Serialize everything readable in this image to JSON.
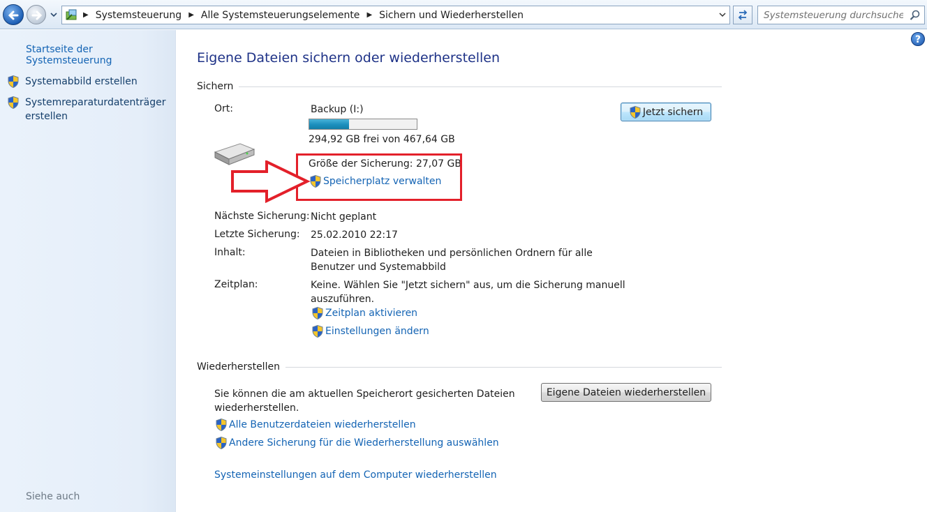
{
  "address_bar": {
    "breadcrumbs": [
      "Systemsteuerung",
      "Alle Systemsteuerungselemente",
      "Sichern und Wiederherstellen"
    ],
    "search_placeholder": "Systemsteuerung durchsuchen"
  },
  "sidebar": {
    "home": "Startseite der Systemsteuerung",
    "items": [
      {
        "label": "Systemabbild erstellen"
      },
      {
        "label": "Systemreparaturdatenträger erstellen"
      }
    ],
    "see_also": "Siehe auch"
  },
  "help": {
    "symbol": "?"
  },
  "main": {
    "title": "Eigene Dateien sichern oder wiederherstellen",
    "backup": {
      "heading": "Sichern",
      "location_label": "Ort:",
      "location_value": "Backup (I:)",
      "used_fraction": 0.37,
      "free_space": "294,92 GB frei von 467,64 GB",
      "backup_size": "Größe der Sicherung: 27,07 GB",
      "manage_space_link": "Speicherplatz verwalten",
      "backup_now_button": "Jetzt sichern",
      "next_label": "Nächste Sicherung:",
      "next_value": "Nicht geplant",
      "last_label": "Letzte Sicherung:",
      "last_value": "25.02.2010 22:17",
      "content_label": "Inhalt:",
      "content_value_1": "Dateien in Bibliotheken und persönlichen Ordnern für alle",
      "content_value_2": "Benutzer und Systemabbild",
      "schedule_label": "Zeitplan:",
      "schedule_value_1": "Keine. Wählen Sie \"Jetzt sichern\" aus, um die Sicherung manuell",
      "schedule_value_2": "auszuführen.",
      "activate_schedule_link": "Zeitplan aktivieren",
      "change_settings_link": "Einstellungen ändern"
    },
    "restore": {
      "heading": "Wiederherstellen",
      "text_1": "Sie können die am aktuellen Speicherort gesicherten Dateien",
      "text_2": "wiederherstellen.",
      "restore_button": "Eigene Dateien wiederherstellen",
      "all_users_link": "Alle Benutzerdateien wiederherstellen",
      "other_backup_link": "Andere Sicherung für die Wiederherstellung auswählen",
      "system_settings_link": "Systemeinstellungen auf dem Computer wiederherstellen"
    }
  },
  "colors": {
    "link": "#1464b4",
    "title": "#1e3287",
    "annotation": "#e3202a",
    "bar_fill": "#1c8fbd"
  }
}
